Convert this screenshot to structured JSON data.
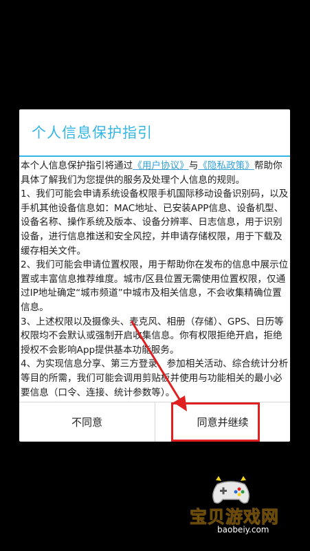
{
  "dialog": {
    "title": "个人信息保护指引",
    "intro_pre": "本个人信息保护指引将通过",
    "link_user_agreement": "《用户协议》",
    "intro_and": "与",
    "link_privacy_policy": "《隐私政策》",
    "intro_post": "帮助你具体了解我们为您提供的服务及处理个人信息的规则。",
    "paragraphs": [
      "1、我们可能会申请系统设备权限手机国际移动设备识别码，以及手机其他设备信息如：MAC地址、已安装APP信息、设备机型、设备名称、操作系统及版本、设备分辨率、日志信息，用于识别设备，进行信息推送和安全风控，并申请存储权限，用于下载及缓存相关文件。",
      "2、我们可能会申请位置权限，用于帮助你在发布的信息中展示位置或丰富信息推荐维度。城市/区县位置无需使用位置权限，仅通过IP地址确定“城市频道”中城市及相关信息，不会收集精确位置信息。",
      "3、上述权限以及摄像头、麦克风、相册（存储）、GPS、日历等权限均不会默认或强制开启收集信息。你有权限拒绝开启，拒绝授权不会影响App提供基本功能服务。",
      "4、为实现信息分享、第三方登录、参加相关活动、综合统计分析等目的所需，我们可能会调用剪贴板并使用与功能相关的最小必要信息（口令、连接、统计参数等）。"
    ],
    "disagree_label": "不同意",
    "agree_label": "同意并继续"
  },
  "watermark": {
    "name": "宝贝游戏网",
    "domain": "baobeiy.com"
  },
  "colors": {
    "accent": "#33b5e5",
    "link": "#33a0d8",
    "annotation": "#e02020",
    "watermark": "#f7d31b"
  }
}
